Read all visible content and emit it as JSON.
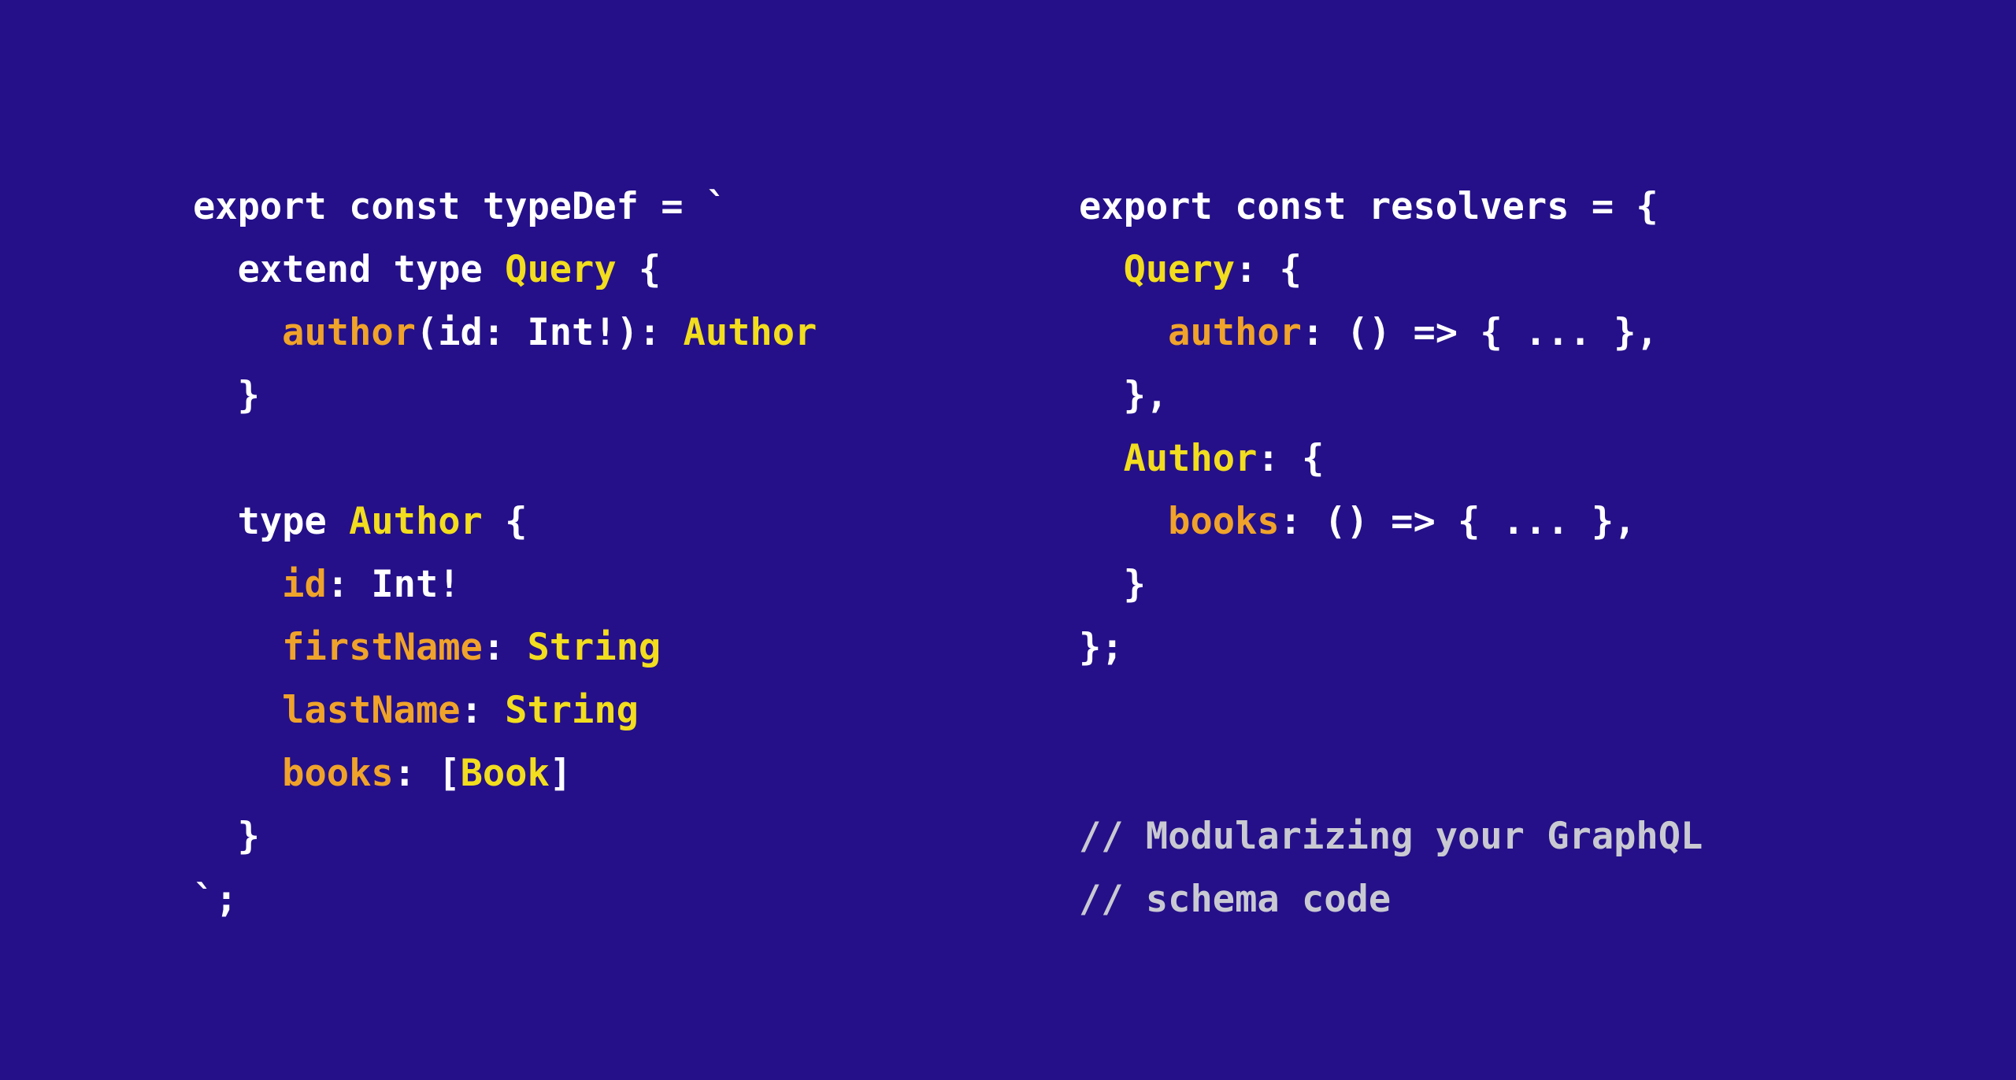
{
  "theme": {
    "background": "#251089",
    "plain": "#ffffff",
    "type": "#f2dd1e",
    "field": "#f0a32a",
    "comment": "#c9c9d2"
  },
  "left_panel": {
    "name": "typedef-snippet",
    "lines": [
      {
        "indent": 0,
        "tokens": [
          {
            "t": "export const typeDef = `",
            "c": "plain"
          }
        ]
      },
      {
        "indent": 2,
        "tokens": [
          {
            "t": "extend type ",
            "c": "plain"
          },
          {
            "t": "Query",
            "c": "type"
          },
          {
            "t": " {",
            "c": "plain"
          }
        ]
      },
      {
        "indent": 4,
        "tokens": [
          {
            "t": "author",
            "c": "field"
          },
          {
            "t": "(id: Int!): ",
            "c": "plain"
          },
          {
            "t": "Author",
            "c": "type"
          }
        ]
      },
      {
        "indent": 2,
        "tokens": [
          {
            "t": "}",
            "c": "plain"
          }
        ]
      },
      {
        "indent": 0,
        "tokens": []
      },
      {
        "indent": 2,
        "tokens": [
          {
            "t": "type ",
            "c": "plain"
          },
          {
            "t": "Author",
            "c": "type"
          },
          {
            "t": " {",
            "c": "plain"
          }
        ]
      },
      {
        "indent": 4,
        "tokens": [
          {
            "t": "id",
            "c": "field"
          },
          {
            "t": ": Int!",
            "c": "plain"
          }
        ]
      },
      {
        "indent": 4,
        "tokens": [
          {
            "t": "firstName",
            "c": "field"
          },
          {
            "t": ": ",
            "c": "plain"
          },
          {
            "t": "String",
            "c": "type"
          }
        ]
      },
      {
        "indent": 4,
        "tokens": [
          {
            "t": "lastName",
            "c": "field"
          },
          {
            "t": ": ",
            "c": "plain"
          },
          {
            "t": "String",
            "c": "type"
          }
        ]
      },
      {
        "indent": 4,
        "tokens": [
          {
            "t": "books",
            "c": "field"
          },
          {
            "t": ": [",
            "c": "plain"
          },
          {
            "t": "Book",
            "c": "type"
          },
          {
            "t": "]",
            "c": "plain"
          }
        ]
      },
      {
        "indent": 2,
        "tokens": [
          {
            "t": "}",
            "c": "plain"
          }
        ]
      },
      {
        "indent": 0,
        "tokens": [
          {
            "t": "`;",
            "c": "plain"
          }
        ]
      }
    ]
  },
  "right_panel": {
    "name": "resolvers-snippet",
    "lines": [
      {
        "indent": 0,
        "tokens": [
          {
            "t": "export const resolvers = {",
            "c": "plain"
          }
        ]
      },
      {
        "indent": 2,
        "tokens": [
          {
            "t": "Query",
            "c": "type"
          },
          {
            "t": ": {",
            "c": "plain"
          }
        ]
      },
      {
        "indent": 4,
        "tokens": [
          {
            "t": "author",
            "c": "field"
          },
          {
            "t": ": () => { ... },",
            "c": "plain"
          }
        ]
      },
      {
        "indent": 2,
        "tokens": [
          {
            "t": "},",
            "c": "plain"
          }
        ]
      },
      {
        "indent": 2,
        "tokens": [
          {
            "t": "Author",
            "c": "type"
          },
          {
            "t": ": {",
            "c": "plain"
          }
        ]
      },
      {
        "indent": 4,
        "tokens": [
          {
            "t": "books",
            "c": "field"
          },
          {
            "t": ": () => { ... },",
            "c": "plain"
          }
        ]
      },
      {
        "indent": 2,
        "tokens": [
          {
            "t": "}",
            "c": "plain"
          }
        ]
      },
      {
        "indent": 0,
        "tokens": [
          {
            "t": "};",
            "c": "plain"
          }
        ]
      },
      {
        "indent": 0,
        "tokens": []
      },
      {
        "indent": 0,
        "tokens": []
      },
      {
        "indent": 0,
        "tokens": [
          {
            "t": "// Modularizing your GraphQL",
            "c": "comment"
          }
        ]
      },
      {
        "indent": 0,
        "tokens": [
          {
            "t": "// schema code",
            "c": "comment"
          }
        ]
      }
    ]
  }
}
